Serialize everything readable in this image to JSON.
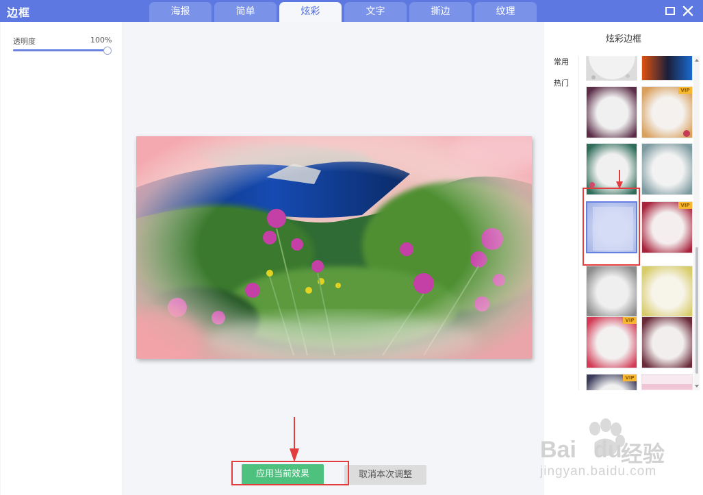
{
  "app": {
    "title": "边框"
  },
  "tabs": [
    {
      "label": "海报",
      "active": false
    },
    {
      "label": "简单",
      "active": false
    },
    {
      "label": "炫彩",
      "active": true
    },
    {
      "label": "文字",
      "active": false
    },
    {
      "label": "撕边",
      "active": false
    },
    {
      "label": "纹理",
      "active": false
    }
  ],
  "window_controls": {
    "maximize_icon": "maximize-icon",
    "close_icon": "close-icon"
  },
  "left_panel": {
    "opacity_label": "透明度",
    "opacity_value": "100%",
    "opacity_fraction": 1.0
  },
  "right_panel": {
    "title": "炫彩边框",
    "categories": [
      "常用",
      "热门"
    ],
    "vip_label": "VIP",
    "frames": [
      {
        "id": "f1",
        "vip": false,
        "selected": false
      },
      {
        "id": "f2",
        "vip": false,
        "selected": false
      },
      {
        "id": "f3",
        "vip": false,
        "selected": false
      },
      {
        "id": "f4",
        "vip": true,
        "selected": false
      },
      {
        "id": "f5",
        "vip": true,
        "selected": false
      },
      {
        "id": "f6",
        "vip": false,
        "selected": false
      },
      {
        "id": "f7",
        "vip": false,
        "selected": true
      },
      {
        "id": "f8",
        "vip": true,
        "selected": false
      },
      {
        "id": "f9",
        "vip": false,
        "selected": false
      },
      {
        "id": "f10",
        "vip": false,
        "selected": false
      },
      {
        "id": "f11",
        "vip": true,
        "selected": false
      },
      {
        "id": "f12",
        "vip": false,
        "selected": false
      },
      {
        "id": "f13",
        "vip": true,
        "selected": false
      },
      {
        "id": "f14",
        "vip": false,
        "selected": false
      }
    ]
  },
  "buttons": {
    "apply": "应用当前效果",
    "cancel": "取消本次调整"
  },
  "watermark": {
    "brand_left": "Bai",
    "brand_right": "du",
    "cn": "经验",
    "url": "jingyan.baidu.com"
  },
  "colors": {
    "titlebar": "#5d79e1",
    "apply_button": "#4ec17e",
    "annotation": "#e23c3c",
    "vip_badge": "#f7b82f"
  }
}
